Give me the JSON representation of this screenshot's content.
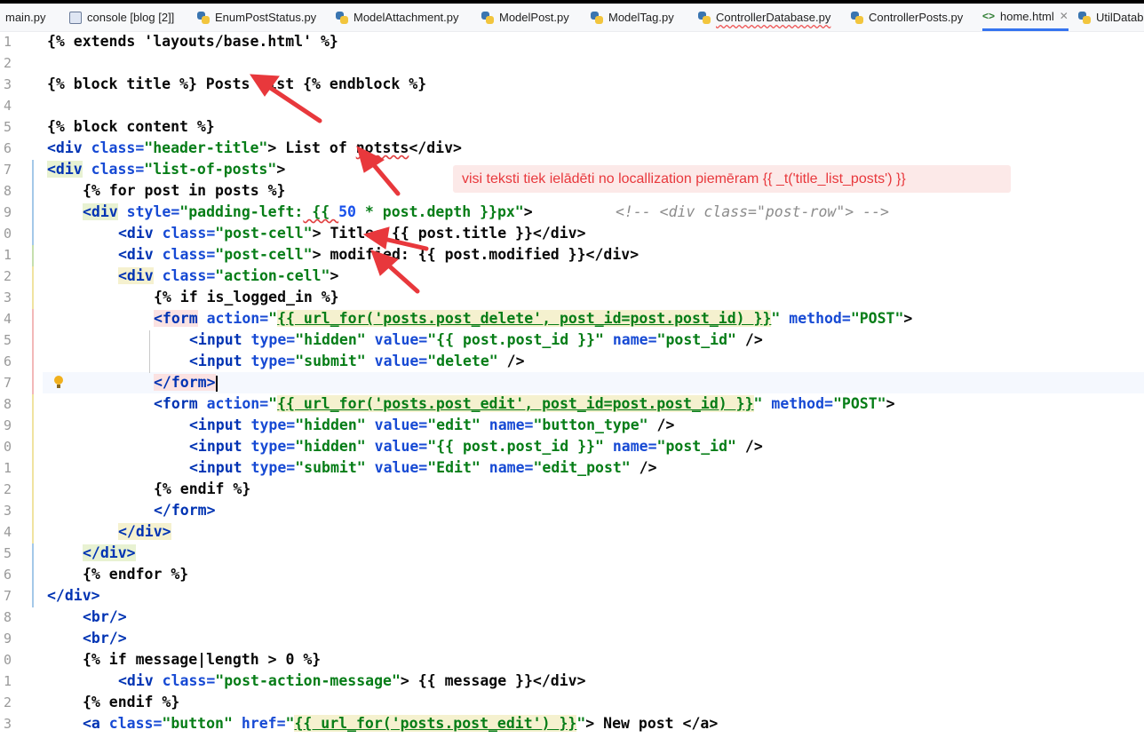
{
  "tabs": [
    {
      "label": "main.py",
      "type": "py"
    },
    {
      "label": "console [blog [2]]",
      "type": "console"
    },
    {
      "label": "EnumPostStatus.py",
      "type": "py"
    },
    {
      "label": "ModelAttachment.py",
      "type": "py"
    },
    {
      "label": "ModelPost.py",
      "type": "py"
    },
    {
      "label": "ModelTag.py",
      "type": "py"
    },
    {
      "label": "ControllerDatabase.py",
      "type": "py"
    },
    {
      "label": "ControllerPosts.py",
      "type": "py"
    },
    {
      "label": "home.html",
      "type": "html",
      "active": true
    },
    {
      "label": "UtilDatab",
      "type": "py"
    }
  ],
  "line_numbers": [
    "1",
    "2",
    "3",
    "4",
    "5",
    "6",
    "7",
    "8",
    "9",
    "0",
    "1",
    "2",
    "3",
    "4",
    "5",
    "6",
    "7",
    "8",
    "9",
    "0",
    "1",
    "2",
    "3",
    "4",
    "5",
    "6",
    "7",
    "8",
    "9",
    "0",
    "1",
    "2",
    "3"
  ],
  "code": {
    "l1": "{% extends 'layouts/base.html' %}",
    "l3": "{% block title %} Posts list {% endblock %}",
    "l5": "{% block content %}",
    "l6_open": "<div",
    "l6_attr": " class=",
    "l6_val": "\"header-title\"",
    "l6_text": "> List of ",
    "l6_typo": "notsts",
    "l6_close": "</div>",
    "l7_open": "<div",
    "l7_attr": " class=",
    "l7_val": "\"list-of-posts\"",
    "l7_end": ">",
    "l8": "{% for post in posts %}",
    "l9_open": "<div",
    "l9_attr": " style=",
    "l9_val_a": "\"padding-left:",
    "l9_val_b": " {{ ",
    "l9_num": "50",
    "l9_val_c": " * post.depth }}px\"",
    "l9_end": ">",
    "l9_comment": "<!-- <div class=\"post-row\"> -->",
    "l10": "> Title: {{ post.title }}</div>",
    "l11": "> modified: {{ post.modified }}</div>",
    "cls_post_cell": "\"post-cell\"",
    "cls_action_cell": "\"action-cell\"",
    "l13": "{% if is_logged_in %}",
    "l14_url": "{{ url_for('posts.post_delete', post_id=post.post_id) }}",
    "l15_val": "\"{{ post.post_id }}\"",
    "l15_name": "\"post_id\"",
    "hidden": "\"hidden\"",
    "submit": "\"submit\"",
    "delete": "\"delete\"",
    "post": "\"POST\"",
    "l17": "</form>",
    "l18_url": "{{ url_for('posts.post_edit', post_id=post.post_id) }}",
    "edit": "\"edit\"",
    "button_type": "\"button_type\"",
    "edit_cap": "\"Edit\"",
    "edit_post": "\"edit_post\"",
    "l22": "{% endif %}",
    "l23": "</form>",
    "l24": "</div>",
    "l25": "</div>",
    "l26": "{% endfor %}",
    "l27": "</div>",
    "l28": "<br/>",
    "l29": "<br/>",
    "l30": "{% if message|length > 0 %}",
    "cls_msg": "\"post-action-message\"",
    "l31_text": "> {{ message }}</div>",
    "l32": "{% endif %}",
    "cls_button": "\"button\"",
    "l33_url": "{{ url_for('posts.post_edit') }}",
    "l33_text": "> New post </a>"
  },
  "annotation": "visi teksti tiek ielādēti no locallization piemēram  {{ _t('title_list_posts') }}",
  "colors": {
    "tag": "#0033b3",
    "attr_value": "#067d17",
    "annotation_red": "#e8383c"
  }
}
